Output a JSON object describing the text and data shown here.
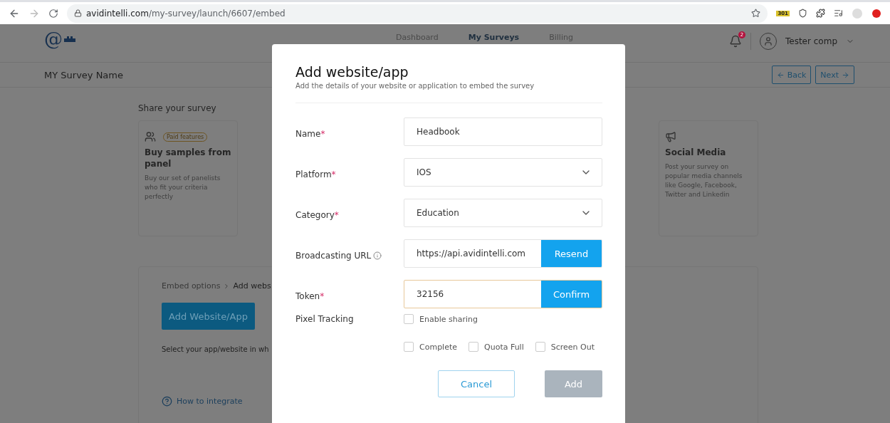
{
  "logo": "@",
  "browser": {
    "url_host": "avidintelli.com",
    "url_path": "/my-survey/launch/6607/embed",
    "extension_badge": "301"
  },
  "header": {
    "nav": [
      {
        "label": "Dashboard",
        "selected": false
      },
      {
        "label": "My Surveys",
        "selected": true
      },
      {
        "label": "Billing",
        "selected": false
      }
    ],
    "notification_count": "2",
    "user": "Tester comp"
  },
  "subheader": {
    "title": "MY Survey Name",
    "back": "Back",
    "next": "Next"
  },
  "share": {
    "heading": "Share your survey",
    "cards": [
      {
        "kind": "panel",
        "badge": "Paid features",
        "title": "Buy samples from panel",
        "text": "Buy our set of panelists who fit your criteria perfectly",
        "selected": false
      },
      {
        "kind": "social",
        "title": "Social Media",
        "text": "Post your survey on popular media channels like Google, Facebook, Twitter and Linkedin",
        "selected": false
      }
    ]
  },
  "embed": {
    "breadcrumb": [
      "Embed options",
      "Add webs"
    ],
    "add_button": "Add Website/App",
    "hint": "Select your app/website in wh",
    "help_link": "How to integrate"
  },
  "modal": {
    "required_mark": "*",
    "title": "Add website/app",
    "subtitle": "Add the details of your website or application to embed the survey",
    "fields": [
      {
        "kind": "text",
        "label": "Name",
        "required": true,
        "value": "Headbook",
        "focused": false
      },
      {
        "kind": "select",
        "label": "Platform",
        "required": true,
        "value": "IOS",
        "focused": false
      },
      {
        "kind": "select",
        "label": "Category",
        "required": true,
        "value": "Education",
        "focused": false
      },
      {
        "kind": "action",
        "label": "Broadcasting URL",
        "required": false,
        "info": true,
        "value": "https://api.avidintelli.com",
        "action": "Resend",
        "focused": false
      },
      {
        "kind": "action",
        "label": "Token",
        "required": true,
        "value": "32156",
        "action": "Confirm",
        "focused": true
      }
    ],
    "pixel_tracking": {
      "label": "Pixel Tracking",
      "enable": {
        "label": "Enable sharing",
        "checked": false
      },
      "options": [
        {
          "label": "Complete",
          "checked": false
        },
        {
          "label": "Quota Full",
          "checked": false
        },
        {
          "label": "Screen Out",
          "checked": false
        }
      ]
    },
    "cancel": "Cancel",
    "add": "Add",
    "add_disabled": true
  }
}
